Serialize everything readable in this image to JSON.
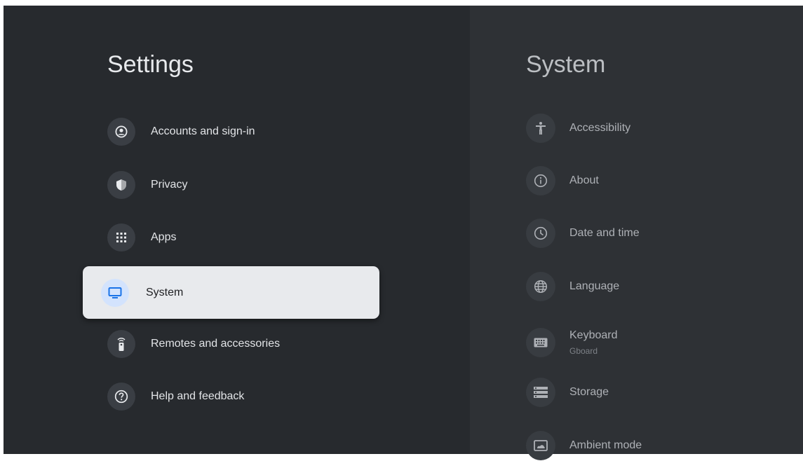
{
  "left_panel": {
    "title": "Settings",
    "items": [
      {
        "label": "Accounts and sign-in",
        "icon": "account-circle-icon"
      },
      {
        "label": "Privacy",
        "icon": "shield-icon"
      },
      {
        "label": "Apps",
        "icon": "apps-grid-icon"
      },
      {
        "label": "System",
        "icon": "tv-icon",
        "selected": true
      },
      {
        "label": "Remotes and accessories",
        "icon": "remote-icon"
      },
      {
        "label": "Help and feedback",
        "icon": "help-icon"
      }
    ]
  },
  "right_panel": {
    "title": "System",
    "items": [
      {
        "label": "Accessibility",
        "icon": "accessibility-icon"
      },
      {
        "label": "About",
        "icon": "info-icon"
      },
      {
        "label": "Date and time",
        "icon": "clock-icon"
      },
      {
        "label": "Language",
        "icon": "globe-icon"
      },
      {
        "label": "Keyboard",
        "sublabel": "Gboard",
        "icon": "keyboard-icon"
      },
      {
        "label": "Storage",
        "icon": "storage-icon"
      },
      {
        "label": "Ambient mode",
        "icon": "ambient-mode-icon"
      }
    ]
  },
  "colors": {
    "background": "#272a2e",
    "right_panel_background": "#2e3135",
    "selected_item_background": "#e8eaed",
    "selected_icon_background": "#d3e3fd",
    "selected_icon_accent": "#1a73e8"
  }
}
